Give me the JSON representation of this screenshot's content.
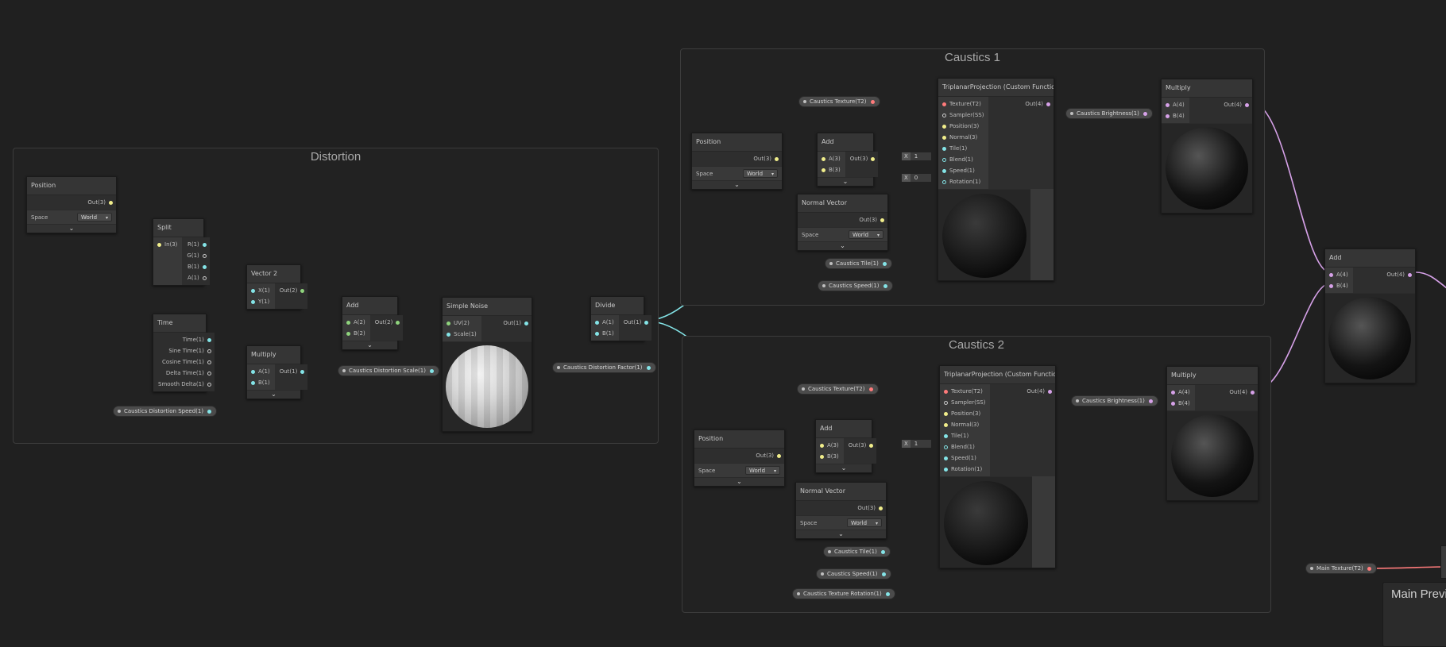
{
  "colors": {
    "background": "#202020",
    "group_border": "#3c3c3c",
    "node_body": "#393939",
    "wire_vector1": "#84e4e7",
    "wire_vector2": "#8fd37d",
    "wire_vector3": "#f0ed8b",
    "wire_vector4": "#d6a1e8",
    "wire_texture": "#ff7b7b"
  },
  "groups": {
    "distortion": "Distortion",
    "caustics1": "Caustics 1",
    "caustics2": "Caustics 2"
  },
  "nodes": {
    "position_d": {
      "title": "Position",
      "out": "Out(3)",
      "space_label": "Space",
      "space_value": "World"
    },
    "split": {
      "title": "Split",
      "in": "In(3)",
      "outs": [
        "R(1)",
        "G(1)",
        "B(1)",
        "A(1)"
      ]
    },
    "vector2": {
      "title": "Vector 2",
      "ins": [
        "X(1)",
        "Y(1)"
      ],
      "out": "Out(2)"
    },
    "time": {
      "title": "Time",
      "outs": [
        "Time(1)",
        "Sine Time(1)",
        "Cosine Time(1)",
        "Delta Time(1)",
        "Smooth Delta(1)"
      ]
    },
    "multiply_d": {
      "title": "Multiply",
      "ins": [
        "A(1)",
        "B(1)"
      ],
      "out": "Out(1)"
    },
    "add_d": {
      "title": "Add",
      "ins": [
        "A(2)",
        "B(2)"
      ],
      "out": "Out(2)"
    },
    "simple_noise": {
      "title": "Simple Noise",
      "ins": [
        "UV(2)",
        "Scale(1)"
      ],
      "out": "Out(1)"
    },
    "divide": {
      "title": "Divide",
      "ins": [
        "A(1)",
        "B(1)"
      ],
      "out": "Out(1)"
    },
    "position_c1": {
      "title": "Position",
      "out": "Out(3)",
      "space_label": "Space",
      "space_value": "World"
    },
    "add_c1": {
      "title": "Add",
      "ins": [
        "A(3)",
        "B(3)"
      ],
      "out": "Out(3)"
    },
    "normal_c1": {
      "title": "Normal Vector",
      "out": "Out(3)",
      "space_label": "Space",
      "space_value": "World"
    },
    "triplanar_c1": {
      "title": "TriplanarProjection (Custom Function)",
      "ins": [
        "Texture(T2)",
        "Sampler(SS)",
        "Position(3)",
        "Normal(3)",
        "Tile(1)",
        "Blend(1)",
        "Speed(1)",
        "Rotation(1)"
      ],
      "out": "Out(4)"
    },
    "multiply_c1": {
      "title": "Multiply",
      "ins": [
        "A(4)",
        "B(4)"
      ],
      "out": "Out(4)"
    },
    "position_c2": {
      "title": "Position",
      "out": "Out(3)",
      "space_label": "Space",
      "space_value": "World"
    },
    "add_c2": {
      "title": "Add",
      "ins": [
        "A(3)",
        "B(3)"
      ],
      "out": "Out(3)"
    },
    "normal_c2": {
      "title": "Normal Vector",
      "out": "Out(3)",
      "space_label": "Space",
      "space_value": "World"
    },
    "triplanar_c2": {
      "title": "TriplanarProjection (Custom Function)",
      "ins": [
        "Texture(T2)",
        "Sampler(SS)",
        "Position(3)",
        "Normal(3)",
        "Tile(1)",
        "Blend(1)",
        "Speed(1)",
        "Rotation(1)"
      ],
      "out": "Out(4)"
    },
    "multiply_c2": {
      "title": "Multiply",
      "ins": [
        "A(4)",
        "B(4)"
      ],
      "out": "Out(4)"
    },
    "add_final": {
      "title": "Add",
      "ins": [
        "A(4)",
        "B(4)"
      ],
      "out": "Out(4)"
    }
  },
  "inline_fields": {
    "c1_blend": {
      "axis": "X",
      "value": "1"
    },
    "c1_rotation": {
      "axis": "X",
      "value": "0"
    },
    "c2_blend": {
      "axis": "X",
      "value": "1"
    }
  },
  "properties": {
    "distortion_speed": "Caustics Distortion Speed(1)",
    "distortion_scale": "Caustics Distortion Scale(1)",
    "distortion_factor": "Caustics Distortion Factor(1)",
    "c1_texture": "Caustics Texture(T2)",
    "c1_tile": "Caustics Tile(1)",
    "c1_speed": "Caustics Speed(1)",
    "c1_brightness": "Caustics Brightness(1)",
    "c2_texture": "Caustics Texture(T2)",
    "c2_tile": "Caustics Tile(1)",
    "c2_speed": "Caustics Speed(1)",
    "c2_rotation": "Caustics Texture Rotation(1)",
    "c2_brightness": "Caustics Brightness(1)",
    "main_texture": "Main Texture(T2)"
  },
  "main_preview": {
    "title": "Main Preview"
  }
}
